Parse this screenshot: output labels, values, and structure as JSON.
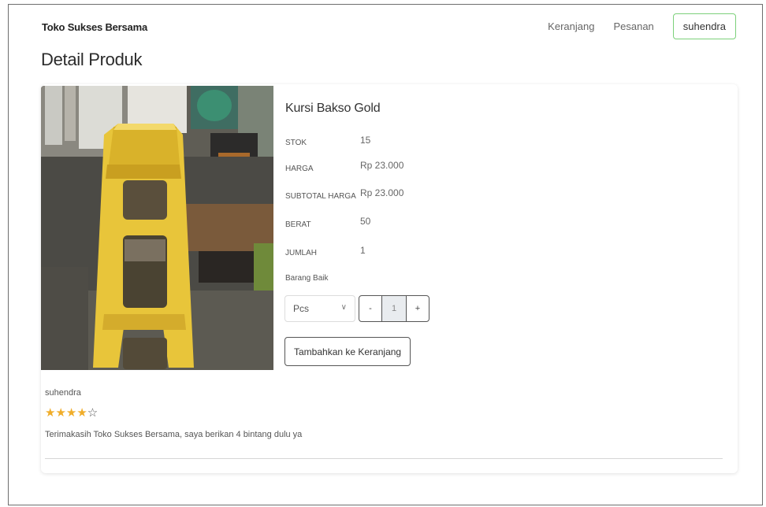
{
  "header": {
    "brand": "Toko Sukses Bersama",
    "nav": {
      "cart": "Keranjang",
      "orders": "Pesanan",
      "user": "suhendra"
    }
  },
  "page": {
    "title": "Detail Produk"
  },
  "product": {
    "name": "Kursi Bakso Gold",
    "specs": {
      "stock_label": "STOK",
      "stock_value": "15",
      "price_label": "HARGA",
      "price_value": "Rp 23.000",
      "subtotal_label": "SUBTOTAL HARGA",
      "subtotal_value": "Rp 23.000",
      "weight_label": "BERAT",
      "weight_value": "50",
      "qty_label": "JUMLAH",
      "qty_value": "1"
    },
    "condition": "Barang Baik",
    "unit_select": {
      "selected": "Pcs"
    },
    "quantity": {
      "minus": "-",
      "value": "1",
      "plus": "+"
    },
    "add_to_cart": "Tambahkan ke Keranjang"
  },
  "review": {
    "user": "suhendra",
    "rating": 4,
    "max_rating": 5,
    "stars_filled": "★★★★",
    "stars_empty": "☆",
    "comment": "Terimakasih Toko Sukses Bersama, saya berikan 4 bintang dulu ya"
  },
  "colors": {
    "accent_green": "#7cd07a",
    "star": "#f0ad2a"
  },
  "icons": {
    "select_arrow": "chevron-down-icon"
  }
}
